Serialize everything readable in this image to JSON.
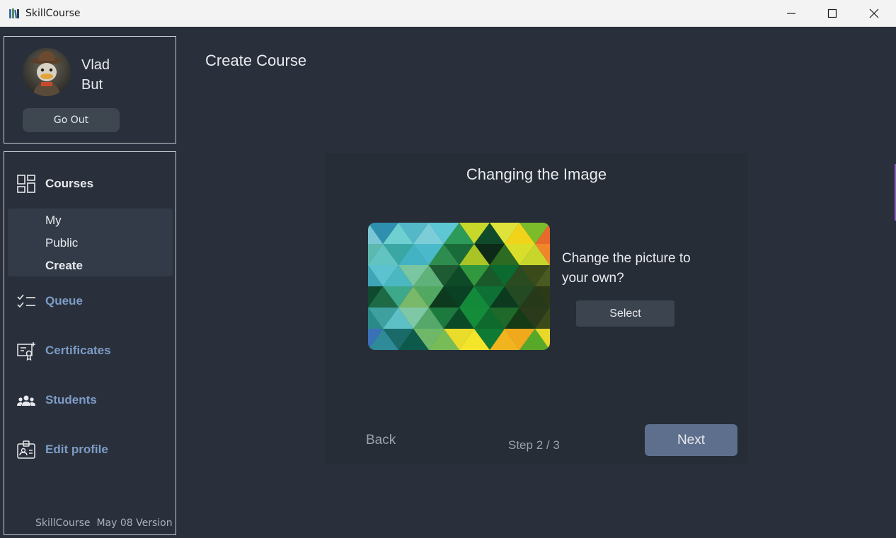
{
  "window": {
    "title": "SkillCourse"
  },
  "profile": {
    "first_name": "Vlad",
    "last_name": "But",
    "go_out_label": "Go Out"
  },
  "nav": {
    "courses": "Courses",
    "sub": {
      "my": "My",
      "public": "Public",
      "create": "Create"
    },
    "queue": "Queue",
    "certificates": "Certificates",
    "students": "Students",
    "edit_profile": "Edit profile"
  },
  "footer": {
    "app": "SkillCourse",
    "version": "May 08 Version"
  },
  "main": {
    "title": "Create Course",
    "card_title": "Changing the Image",
    "change_prompt": "Change the picture to your own?",
    "select_label": "Select",
    "back_label": "Back",
    "step_text": "Step 2 / 3",
    "next_label": "Next"
  },
  "colors": {
    "background": "#2a303b",
    "card": "#262d37",
    "accent_link": "#7d9cc7",
    "next_button": "#5d6f8c"
  }
}
